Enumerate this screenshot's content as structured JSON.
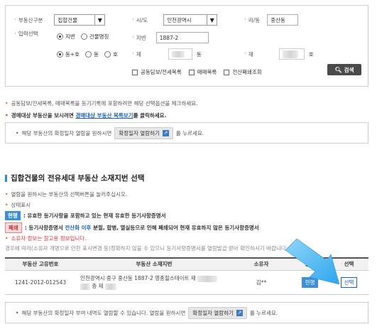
{
  "search": {
    "type_label": "부동산구분",
    "type_value": "집합건물",
    "sido_label": "시/도",
    "sido_value": "인천광역시",
    "dong_label": "리/동",
    "dong_value": "중산동",
    "input_label": "입력선택",
    "radio_jibun": "지번",
    "radio_building": "건물명칭",
    "jibun_label": "지번",
    "jibun_value": "1887-2",
    "radio_dong_ho": "동+호",
    "radio_dong": "동",
    "radio_ho": "호",
    "je1": "제",
    "dong_unit": "동",
    "je2": "제",
    "ho_unit": "호",
    "check_mortgage": "공동담보/전세목록",
    "check_sale": "매매목록",
    "check_closed": "전산폐쇄조회",
    "search_button": "검색"
  },
  "notes": {
    "line1": "공동담보/전세목록, 매매목록을 등기기록에 포함하려면 해당 선택옵션을 체크하세요.",
    "line2_pre": "경매대상 부동산을 보시려면 ",
    "line2_link": "경매대상 부동산 목록보기",
    "line2_post": "를 클릭하세요."
  },
  "info1": {
    "pre": "해당 부동산의 확정일자 열람을 원하시면",
    "button": "확정일자 열람하기",
    "post": "를 누르세요."
  },
  "section": {
    "title": "집합건물의 전유세대 부동산 소재지번 선택",
    "desc1": "열람을 원하시는 부동산의 선택버튼을 눌러주십시오.",
    "desc2": "상태표시",
    "badge_current": "현행",
    "current_desc": ": 유효한 등기사항을 포함하고 있는 현재 유효한 등기사항증명서",
    "badge_closed": "폐쇄",
    "closed_desc_pre": ": 등기사항증명서 ",
    "closed_desc_red": "전산화 이후",
    "closed_desc_post": " 분필, 합병, 멸실등으로 인해 폐쇄되어 현재 유효하지 않은 등기사항증명서",
    "owner_note": "소유자 정보는 참고용 정보입니다.",
    "warn": "경우에 따라(소유자 개명으로 인한 표시변경 등)정확하지 않을 수 있으니 등기사항증명서를 열람발급 받아 확인하시기 바랍니다."
  },
  "table": {
    "headers": [
      "부동산 고유번호",
      "부동산 소재지번",
      "소유자",
      "상태",
      "선택"
    ],
    "rows": [
      {
        "id": "1241-2012-012543",
        "addr_line1": "인천광역시 중구 중산동 1887-2 영종힐스테이트 제",
        "addr_line2": "층 제",
        "owner": "김**",
        "status": "현행",
        "select": "선택"
      }
    ]
  },
  "info2": {
    "pre": "해당 부동산의 확정일자 부여 내역도 열람할 수 있습니다. 열람을 원하시면",
    "button": "확정일자 열람하기",
    "post": "를 누르세요."
  },
  "colors": {
    "accent_blue": "#3a8fd6",
    "arrow": "#3aaef0",
    "bullet_orange": "#e05a26"
  }
}
